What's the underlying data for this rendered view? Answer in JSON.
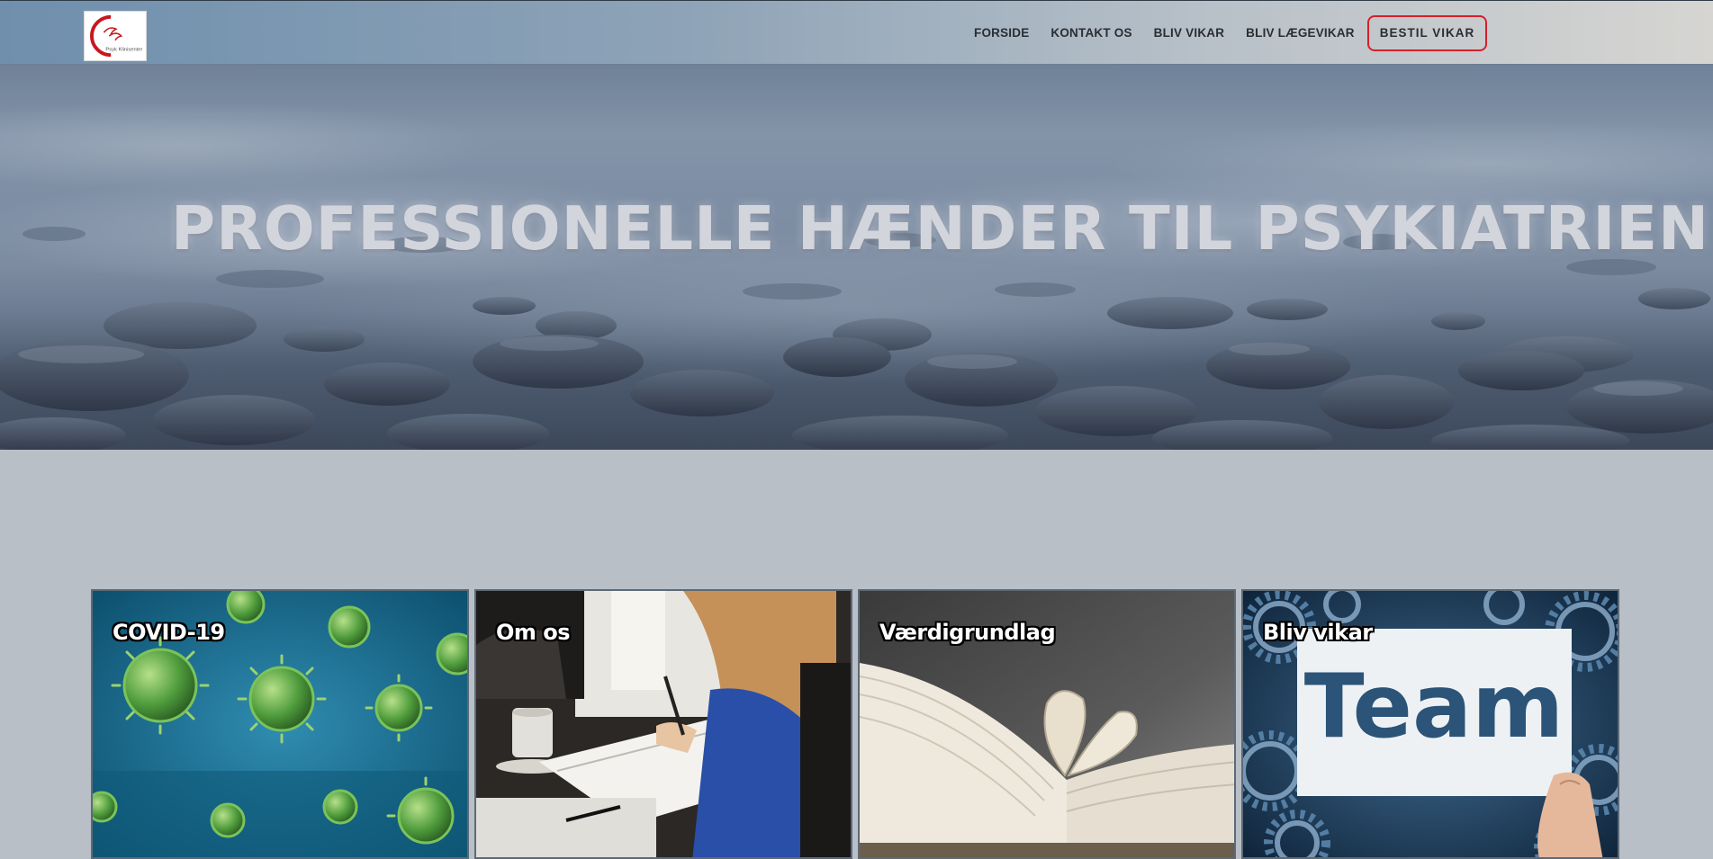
{
  "header": {
    "logo_alt": "Psyk Klinisenter",
    "logo_text": "Psyk Klinisenter",
    "nav": [
      {
        "label": "FORSIDE"
      },
      {
        "label": "KONTAKT OS"
      },
      {
        "label": "BLIV VIKAR"
      },
      {
        "label": "BLIV LÆGEVIKAR"
      },
      {
        "label": "BESTIL VIKAR"
      }
    ],
    "cta_color": "#d5202a"
  },
  "hero": {
    "title": "PROFESSIONELLE HÆNDER TIL PSYKIATRIEN",
    "image": "misty-sea-with-rocks"
  },
  "cards": [
    {
      "title": "COVID-19",
      "image": "green-virus-particles"
    },
    {
      "title": "Om os",
      "image": "people-writing-at-table"
    },
    {
      "title": "Værdigrundlag",
      "image": "open-book-heart-pages"
    },
    {
      "title": "Bliv vikar",
      "image": "team-sign-with-gears",
      "image_text": "Team"
    }
  ],
  "colors": {
    "page_background": "#b9bfc6",
    "nav_text": "#2a2e33",
    "hero_title": "#d3d5dc"
  }
}
